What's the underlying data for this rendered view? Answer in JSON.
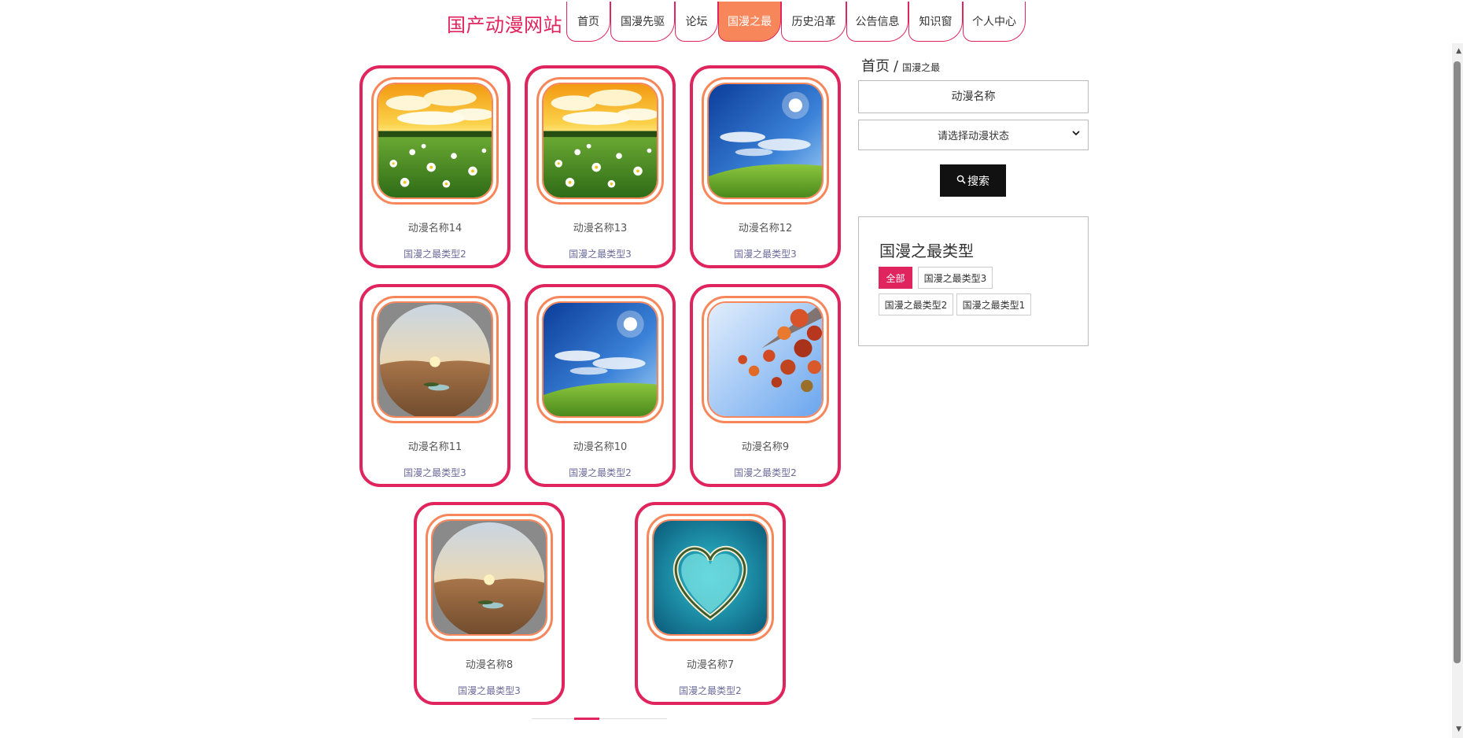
{
  "header": {
    "site_title": "国产动漫网站",
    "nav": [
      {
        "label": "首页"
      },
      {
        "label": "国漫先驱"
      },
      {
        "label": "论坛"
      },
      {
        "label": "国漫之最"
      },
      {
        "label": "历史沿革"
      },
      {
        "label": "公告信息"
      },
      {
        "label": "知识窗"
      },
      {
        "label": "个人中心"
      }
    ],
    "active_nav": "国漫之最"
  },
  "cards": [
    {
      "name": "动漫名称14",
      "type": "国漫之最类型2",
      "image": "daisy-field-sunset"
    },
    {
      "name": "动漫名称13",
      "type": "国漫之最类型3",
      "image": "daisy-field-sunset"
    },
    {
      "name": "动漫名称12",
      "type": "国漫之最类型3",
      "image": "green-hill-blue-sky"
    },
    {
      "name": "动漫名称11",
      "type": "国漫之最类型3",
      "image": "desert-oasis-fisheye"
    },
    {
      "name": "动漫名称10",
      "type": "国漫之最类型2",
      "image": "green-hill-blue-sky"
    },
    {
      "name": "动漫名称9",
      "type": "国漫之最类型2",
      "image": "autumn-leaves-sky"
    },
    {
      "name": "动漫名称8",
      "type": "国漫之最类型3",
      "image": "desert-oasis-fisheye"
    },
    {
      "name": "动漫名称7",
      "type": "国漫之最类型2",
      "image": "heart-island-ocean"
    }
  ],
  "sidebar": {
    "breadcrumb": {
      "home": "首页",
      "separator": "/",
      "current": "国漫之最"
    },
    "search": {
      "placeholder": "动漫名称",
      "status_select": "请选择动漫状态",
      "button_label": "搜索"
    },
    "types": {
      "title": "国漫之最类型",
      "tags": [
        "全部",
        "国漫之最类型3",
        "国漫之最类型2",
        "国漫之最类型1"
      ],
      "active": "全部"
    }
  },
  "colors": {
    "accent": "#e0245e",
    "active_nav": "#f7865a",
    "search_button": "#111111"
  }
}
